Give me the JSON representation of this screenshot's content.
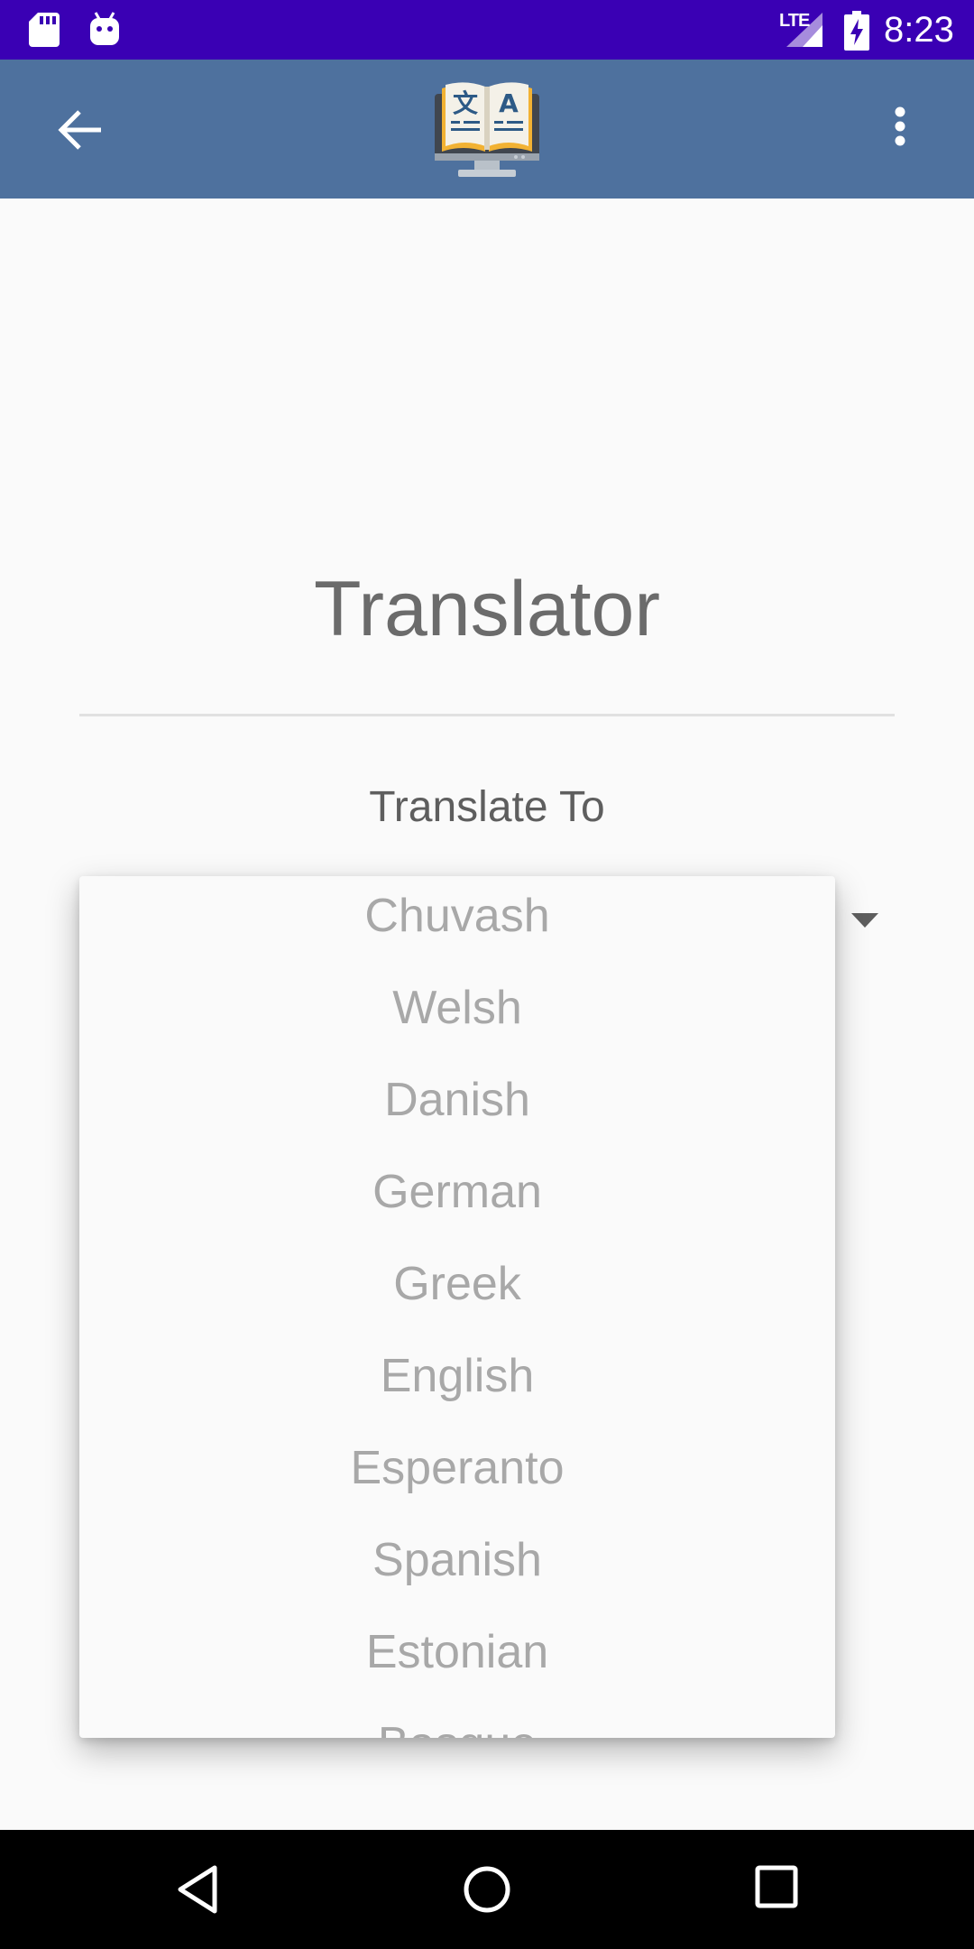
{
  "status_bar": {
    "time": "8:23",
    "network": "LTE",
    "icons": [
      "sd-card-icon",
      "android-icon",
      "signal-icon",
      "battery-charging-icon"
    ],
    "color": "#3a00b4"
  },
  "app_bar": {
    "color": "#4e719e",
    "icons": [
      "back-arrow-icon",
      "translator-logo-icon",
      "overflow-menu-icon"
    ]
  },
  "main": {
    "title": "Translator",
    "label": "Translate To"
  },
  "dropdown": {
    "items": [
      "Chuvash",
      "Welsh",
      "Danish",
      "German",
      "Greek",
      "English",
      "Esperanto",
      "Spanish",
      "Estonian",
      "Basque"
    ]
  },
  "nav_bar": {
    "icons": [
      "nav-back-icon",
      "nav-home-icon",
      "nav-recents-icon"
    ]
  }
}
